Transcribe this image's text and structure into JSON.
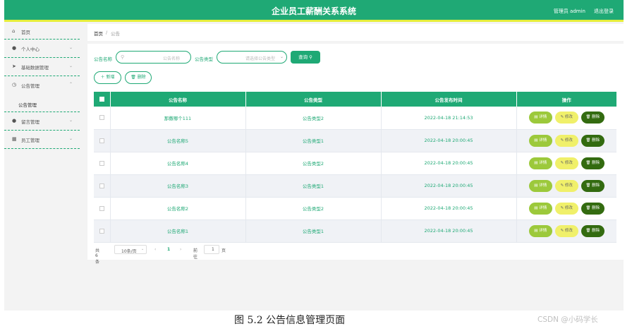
{
  "header": {
    "title": "企业员工薪酬关系系统",
    "admin": "管理员 admin",
    "logout": "退出登录"
  },
  "sidebar": {
    "items": [
      {
        "label": "首页",
        "icon": "home-icon",
        "glyph": "⌂"
      },
      {
        "label": "个人中心",
        "icon": "user-icon",
        "glyph": "●",
        "chev": "⌄"
      },
      {
        "label": "基础数据管理",
        "icon": "send-icon",
        "glyph": "➤",
        "chev": "⌄"
      },
      {
        "label": "公告管理",
        "icon": "clock-icon",
        "glyph": "◷",
        "chev": "⌃"
      },
      {
        "label": "公告管理",
        "sub": true
      },
      {
        "label": "留言管理",
        "icon": "user-icon",
        "glyph": "●",
        "chev": "⌄"
      },
      {
        "label": "员工管理",
        "icon": "grid-icon",
        "glyph": "▦",
        "chev": "⌄"
      }
    ]
  },
  "breadcrumb": {
    "home": "首页",
    "sep": "/",
    "current": "公告"
  },
  "search": {
    "name_label": "公告名称",
    "name_placeholder": "公告名称",
    "type_label": "公告类型",
    "type_placeholder": "请选择公告类型",
    "query_label": "查询"
  },
  "actions": {
    "add": "＋ 新增",
    "delete": "🗑 删除"
  },
  "table": {
    "headers": [
      "公告名称",
      "公告类型",
      "公告发布时间",
      "操作"
    ],
    "rows": [
      {
        "name": "那撒哪个111",
        "type": "公告类型2",
        "time": "2022-04-18 21:14:53"
      },
      {
        "name": "公告名称5",
        "type": "公告类型1",
        "time": "2022-04-18 20:00:45"
      },
      {
        "name": "公告名称4",
        "type": "公告类型2",
        "time": "2022-04-18 20:00:45"
      },
      {
        "name": "公告名称3",
        "type": "公告类型1",
        "time": "2022-04-18 20:00:45"
      },
      {
        "name": "公告名称2",
        "type": "公告类型2",
        "time": "2022-04-18 20:00:45"
      },
      {
        "name": "公告名称1",
        "type": "公告类型1",
        "time": "2022-04-18 20:00:45"
      }
    ],
    "ops": {
      "detail": "详情",
      "edit": "修改",
      "del": "删除"
    }
  },
  "pager": {
    "total": "共 6 条",
    "page_size": "10条/页",
    "prev": "‹",
    "page": "1",
    "next": "›",
    "goto": "前往",
    "goto_value": "1",
    "page_unit": "页"
  },
  "caption": "图 5.2 公告信息管理页面",
  "watermark": "CSDN @小码学长",
  "colors": {
    "primary": "#1fa975",
    "accent_bar": "#e6ee3c",
    "detail": "#9cc93b",
    "edit": "#f0f06a",
    "delete": "#336b10"
  }
}
